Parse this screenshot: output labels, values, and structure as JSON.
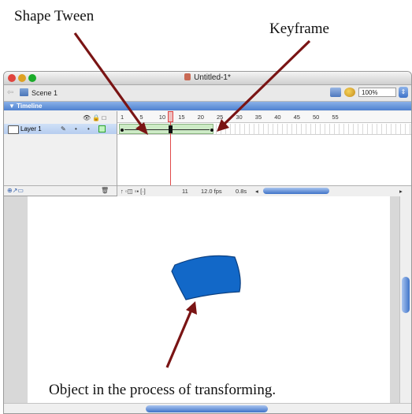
{
  "annotations": {
    "shape_tween": "Shape Tween",
    "keyframe": "Keyframe",
    "object_caption": "Object in the process of transforming."
  },
  "window": {
    "title": "Untitled-1*",
    "traffic_colors": [
      "#e0443e",
      "#dea123",
      "#1aab29"
    ]
  },
  "edit_bar": {
    "scene_label": "Scene 1",
    "zoom_value": "100%"
  },
  "timeline": {
    "panel_title": "▼ Timeline",
    "layer_name": "Layer 1",
    "frame_numbers": [
      "1",
      "5",
      "10",
      "15",
      "20",
      "25",
      "30",
      "35",
      "40",
      "45",
      "50",
      "55"
    ],
    "current_frame": "11",
    "frame_rate": "12.0 fps",
    "elapsed_time": "0.8s"
  },
  "stage": {
    "shape_color": "#1268c8",
    "shape_stroke": "#0b3f80"
  },
  "colors": {
    "arrow": "#7a1414",
    "tween_fill": "#cdebc6"
  }
}
